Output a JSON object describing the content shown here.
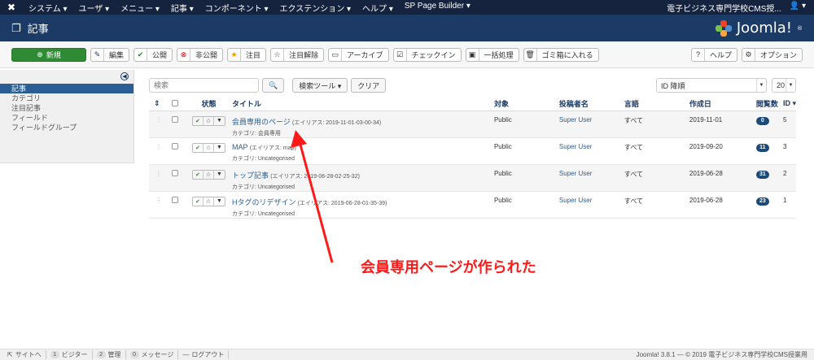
{
  "topnav": {
    "menu": [
      "システム ▾",
      "ユーザ ▾",
      "メニュー ▾",
      "記事 ▾",
      "コンポーネント ▾",
      "エクステンション ▾",
      "ヘルプ ▾",
      "SP Page Builder ▾"
    ],
    "site_name": "電子ビジネス専門学校CMS授...",
    "user_label": "▾"
  },
  "header": {
    "title": "記事",
    "brand": "Joomla!",
    "brand_mark": "®"
  },
  "toolbar": {
    "new_label": "新規",
    "edit_label": "編集",
    "publish_label": "公開",
    "unpublish_label": "非公開",
    "feature_label": "注目",
    "unfeature_label": "注目解除",
    "archive_label": "アーカイブ",
    "checkin_label": "チェックイン",
    "batch_label": "一括処理",
    "trash_label": "ゴミ箱に入れる",
    "help_label": "ヘルプ",
    "options_label": "オプション"
  },
  "sidebar": {
    "items": [
      {
        "label": "記事",
        "active": true
      },
      {
        "label": "カテゴリ",
        "active": false
      },
      {
        "label": "注目記事",
        "active": false
      },
      {
        "label": "フィールド",
        "active": false
      },
      {
        "label": "フィールドグループ",
        "active": false
      }
    ]
  },
  "filters": {
    "search_placeholder": "検索",
    "search_tools_label": "検索ツール ▾",
    "clear_label": "クリア",
    "sort_value": "ID 降順",
    "limit_value": "20"
  },
  "table": {
    "headers": {
      "status": "状態",
      "title": "タイトル",
      "access": "対象",
      "author": "投稿者名",
      "language": "言語",
      "date": "作成日",
      "hits": "閲覧数",
      "id": "ID ▾"
    },
    "rows": [
      {
        "title": "会員専用のページ",
        "alias": "(エイリアス: 2019-11-01-03-00-34)",
        "category": "カテゴリ: 会員専用",
        "access": "Public",
        "author": "Super User",
        "language": "すべて",
        "date": "2019-11-01",
        "hits": "0",
        "id": "5"
      },
      {
        "title": "MAP",
        "alias": "(エイリアス: map)",
        "category": "カテゴリ: Uncategorised",
        "access": "Public",
        "author": "Super User",
        "language": "すべて",
        "date": "2019-09-20",
        "hits": "11",
        "id": "3"
      },
      {
        "title": "トップ記事",
        "alias": "(エイリアス: 2019-06-28-02-25-32)",
        "category": "カテゴリ: Uncategorised",
        "access": "Public",
        "author": "Super User",
        "language": "すべて",
        "date": "2019-06-28",
        "hits": "31",
        "id": "2"
      },
      {
        "title": "Hタグのリデザイン",
        "alias": "(エイリアス: 2019-06-28-01-35-39)",
        "category": "カテゴリ: Uncategorised",
        "access": "Public",
        "author": "Super User",
        "language": "すべて",
        "date": "2019-06-28",
        "hits": "23",
        "id": "1"
      }
    ]
  },
  "annotation": {
    "text": "会員専用ページが作られた",
    "color": "#ff1a1a"
  },
  "footer": {
    "site_label": "サイトへ",
    "visitors_count": "1",
    "visitors_label": "ビジター",
    "admins_count": "2",
    "admins_label": "管理",
    "messages_count": "0",
    "messages_label": "メッセージ",
    "logout_label": "ログアウト",
    "copyright": "Joomla! 3.8.1 — © 2019 電子ビジネス専門学校CMS授業用"
  }
}
